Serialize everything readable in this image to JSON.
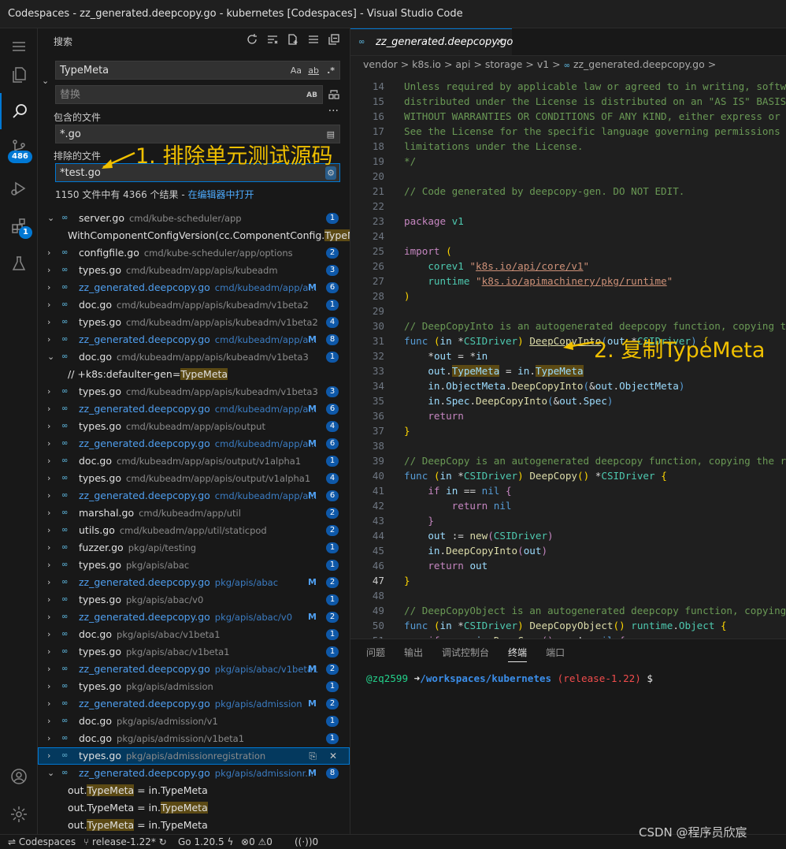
{
  "window": {
    "title": "Codespaces - zz_generated.deepcopy.go - kubernetes [Codespaces] - Visual Studio Code"
  },
  "activity_bar": {
    "source_control_badge": "486",
    "extensions_badge": "1"
  },
  "search": {
    "header": "搜索",
    "query": "TypeMeta",
    "match_case": "Aa",
    "whole_word": "ab",
    "regex": ".*",
    "replace_placeholder": "替换",
    "preserve_case": "AB",
    "include_label": "包含的文件",
    "include_value": "*.go",
    "exclude_label": "排除的文件",
    "exclude_value": "*test.go",
    "summary": "1150 文件中有 4366 个结果 - ",
    "open_in_editor": "在编辑器中打开"
  },
  "results": [
    {
      "kind": "file",
      "expanded": true,
      "name": "server.go",
      "path": "cmd/kube-scheduler/app",
      "count": "1"
    },
    {
      "kind": "match",
      "before": "WithComponentConfigVersion(cc.ComponentConfig.",
      "hit": "TypeMe",
      "after": "..."
    },
    {
      "kind": "file",
      "name": "configfile.go",
      "path": "cmd/kube-scheduler/app/options",
      "count": "2"
    },
    {
      "kind": "file",
      "name": "types.go",
      "path": "cmd/kubeadm/app/apis/kubeadm",
      "count": "3"
    },
    {
      "kind": "file",
      "name": "zz_generated.deepcopy.go",
      "path": "cmd/kubeadm/app/a...",
      "modified": true,
      "m": "M",
      "count": "6"
    },
    {
      "kind": "file",
      "name": "doc.go",
      "path": "cmd/kubeadm/app/apis/kubeadm/v1beta2",
      "count": "1"
    },
    {
      "kind": "file",
      "name": "types.go",
      "path": "cmd/kubeadm/app/apis/kubeadm/v1beta2",
      "count": "4"
    },
    {
      "kind": "file",
      "name": "zz_generated.deepcopy.go",
      "path": "cmd/kubeadm/app/a...",
      "modified": true,
      "m": "M",
      "count": "8"
    },
    {
      "kind": "file",
      "expanded": true,
      "name": "doc.go",
      "path": "cmd/kubeadm/app/apis/kubeadm/v1beta3",
      "count": "1"
    },
    {
      "kind": "match",
      "before": "// +k8s:defaulter-gen=",
      "hit": "TypeMeta",
      "after": ""
    },
    {
      "kind": "file",
      "name": "types.go",
      "path": "cmd/kubeadm/app/apis/kubeadm/v1beta3",
      "count": "3"
    },
    {
      "kind": "file",
      "name": "zz_generated.deepcopy.go",
      "path": "cmd/kubeadm/app/a...",
      "modified": true,
      "m": "M",
      "count": "6"
    },
    {
      "kind": "file",
      "name": "types.go",
      "path": "cmd/kubeadm/app/apis/output",
      "count": "4"
    },
    {
      "kind": "file",
      "name": "zz_generated.deepcopy.go",
      "path": "cmd/kubeadm/app/a...",
      "modified": true,
      "m": "M",
      "count": "6"
    },
    {
      "kind": "file",
      "name": "doc.go",
      "path": "cmd/kubeadm/app/apis/output/v1alpha1",
      "count": "1"
    },
    {
      "kind": "file",
      "name": "types.go",
      "path": "cmd/kubeadm/app/apis/output/v1alpha1",
      "count": "4"
    },
    {
      "kind": "file",
      "name": "zz_generated.deepcopy.go",
      "path": "cmd/kubeadm/app/a...",
      "modified": true,
      "m": "M",
      "count": "6"
    },
    {
      "kind": "file",
      "name": "marshal.go",
      "path": "cmd/kubeadm/app/util",
      "count": "2"
    },
    {
      "kind": "file",
      "name": "utils.go",
      "path": "cmd/kubeadm/app/util/staticpod",
      "count": "2"
    },
    {
      "kind": "file",
      "name": "fuzzer.go",
      "path": "pkg/api/testing",
      "count": "1"
    },
    {
      "kind": "file",
      "name": "types.go",
      "path": "pkg/apis/abac",
      "count": "1"
    },
    {
      "kind": "file",
      "name": "zz_generated.deepcopy.go",
      "path": "pkg/apis/abac",
      "modified": true,
      "m": "M",
      "count": "2"
    },
    {
      "kind": "file",
      "name": "types.go",
      "path": "pkg/apis/abac/v0",
      "count": "1"
    },
    {
      "kind": "file",
      "name": "zz_generated.deepcopy.go",
      "path": "pkg/apis/abac/v0",
      "modified": true,
      "m": "M",
      "count": "2"
    },
    {
      "kind": "file",
      "name": "doc.go",
      "path": "pkg/apis/abac/v1beta1",
      "count": "1"
    },
    {
      "kind": "file",
      "name": "types.go",
      "path": "pkg/apis/abac/v1beta1",
      "count": "1"
    },
    {
      "kind": "file",
      "name": "zz_generated.deepcopy.go",
      "path": "pkg/apis/abac/v1beta1",
      "modified": true,
      "m": "M",
      "count": "2"
    },
    {
      "kind": "file",
      "name": "types.go",
      "path": "pkg/apis/admission",
      "count": "1"
    },
    {
      "kind": "file",
      "name": "zz_generated.deepcopy.go",
      "path": "pkg/apis/admission",
      "modified": true,
      "m": "M",
      "count": "2"
    },
    {
      "kind": "file",
      "name": "doc.go",
      "path": "pkg/apis/admission/v1",
      "count": "1"
    },
    {
      "kind": "file",
      "name": "doc.go",
      "path": "pkg/apis/admission/v1beta1",
      "count": "1"
    },
    {
      "kind": "file",
      "name": "types.go",
      "path": "pkg/apis/admissionregistration",
      "selected": true
    },
    {
      "kind": "file",
      "expanded": true,
      "name": "zz_generated.deepcopy.go",
      "path": "pkg/apis/admissionr...",
      "modified": true,
      "m": "M",
      "count": "8"
    },
    {
      "kind": "match",
      "before": "out.",
      "hit": "TypeMeta",
      "after": " = in.TypeMeta"
    },
    {
      "kind": "match",
      "before": "out.TypeMeta = in.",
      "hit": "TypeMeta",
      "after": ""
    },
    {
      "kind": "match",
      "before": "out.",
      "hit": "TypeMeta",
      "after": " = in.TypeMeta"
    }
  ],
  "editor": {
    "tab": "zz_generated.deepcopy.go",
    "breadcrumb": [
      "vendor",
      "k8s.io",
      "api",
      "storage",
      "v1",
      "zz_generated.deepcopy.go",
      ""
    ],
    "current_line": "47",
    "lines": [
      {
        "n": "14",
        "html": "<span class='cm'>Unless required by applicable law or agreed to in writing, software</span>"
      },
      {
        "n": "15",
        "html": "<span class='cm'>distributed under the License is distributed on an \"AS IS\" BASIS,</span>"
      },
      {
        "n": "16",
        "html": "<span class='cm'>WITHOUT WARRANTIES OR CONDITIONS OF ANY KIND, either express or implied.</span>"
      },
      {
        "n": "17",
        "html": "<span class='cm'>See the License for the specific language governing permissions and</span>"
      },
      {
        "n": "18",
        "html": "<span class='cm'>limitations under the License.</span>"
      },
      {
        "n": "19",
        "html": "<span class='cm'>*/</span>"
      },
      {
        "n": "20",
        "html": ""
      },
      {
        "n": "21",
        "html": "<span class='cm'>// Code generated by deepcopy-gen. DO NOT EDIT.</span>"
      },
      {
        "n": "22",
        "html": ""
      },
      {
        "n": "23",
        "html": "<span class='k'>package</span> <span class='ty'>v1</span>"
      },
      {
        "n": "24",
        "html": ""
      },
      {
        "n": "25",
        "html": "<span class='k'>import</span> <span class='y'>(</span>"
      },
      {
        "n": "26",
        "html": "    <span class='ty'>corev1</span> <span class='s'>\"<u>k8s.io/api/core/v1</u>\"</span>"
      },
      {
        "n": "27",
        "html": "    <span class='ty'>runtime</span> <span class='s'>\"<u>k8s.io/apimachinery/pkg/runtime</u>\"</span>"
      },
      {
        "n": "28",
        "html": "<span class='y'>)</span>"
      },
      {
        "n": "29",
        "html": ""
      },
      {
        "n": "30",
        "html": "<span class='cm'>// DeepCopyInto is an autogenerated deepcopy function, copying the receiver</span>"
      },
      {
        "n": "31",
        "html": "<span class='kw'>func</span> <span class='y'>(</span><span class='v'>in</span> <span class='p'>*</span><span class='ty'>CSIDriver</span><span class='y'>)</span> <span class='fn'><u>DeepCopyInto</u></span><span class='kw'>(</span><span class='v'>out</span> <span class='p'>*</span><span class='ty'>CSIDriver</span><span class='kw'>)</span> <span class='y'>{</span>"
      },
      {
        "n": "32",
        "html": "    <span class='p'>*</span><span class='v'>out</span> <span class='p'>=</span> <span class='p'>*</span><span class='v'>in</span>"
      },
      {
        "n": "33",
        "html": "    <span class='v'>out</span><span class='p'>.</span><span class='v hlw'>TypeMeta</span> <span class='p'>=</span> <span class='v'>in</span><span class='p'>.</span><span class='v hlw'>TypeMeta</span>"
      },
      {
        "n": "34",
        "html": "    <span class='v'>in</span><span class='p'>.</span><span class='v'>ObjectMeta</span><span class='p'>.</span><span class='fn'>DeepCopyInto</span><span class='kw'>(</span><span class='p'>&amp;</span><span class='v'>out</span><span class='p'>.</span><span class='v'>ObjectMeta</span><span class='kw'>)</span>"
      },
      {
        "n": "35",
        "html": "    <span class='v'>in</span><span class='p'>.</span><span class='v'>Spec</span><span class='p'>.</span><span class='fn'>DeepCopyInto</span><span class='kw'>(</span><span class='p'>&amp;</span><span class='v'>out</span><span class='p'>.</span><span class='v'>Spec</span><span class='kw'>)</span>"
      },
      {
        "n": "36",
        "html": "    <span class='k'>return</span>"
      },
      {
        "n": "37",
        "html": "<span class='y'>}</span>"
      },
      {
        "n": "38",
        "html": ""
      },
      {
        "n": "39",
        "html": "<span class='cm'>// DeepCopy is an autogenerated deepcopy function, copying the receiver</span>"
      },
      {
        "n": "40",
        "html": "<span class='kw'>func</span> <span class='y'>(</span><span class='v'>in</span> <span class='p'>*</span><span class='ty'>CSIDriver</span><span class='y'>)</span> <span class='fn'>DeepCopy</span><span class='y'>()</span> <span class='p'>*</span><span class='ty'>CSIDriver</span> <span class='y'>{</span>"
      },
      {
        "n": "41",
        "html": "    <span class='k'>if</span> <span class='v'>in</span> <span class='p'>==</span> <span class='kw'>nil</span> <span class='k'>{</span>"
      },
      {
        "n": "42",
        "html": "        <span class='k'>return</span> <span class='kw'>nil</span>"
      },
      {
        "n": "43",
        "html": "    <span class='k'>}</span>"
      },
      {
        "n": "44",
        "html": "    <span class='v'>out</span> <span class='p'>:=</span> <span class='fn'>new</span><span class='k'>(</span><span class='ty'>CSIDriver</span><span class='k'>)</span>"
      },
      {
        "n": "45",
        "html": "    <span class='v'>in</span><span class='p'>.</span><span class='fn'>DeepCopyInto</span><span class='k'>(</span><span class='v'>out</span><span class='k'>)</span>"
      },
      {
        "n": "46",
        "html": "    <span class='k'>return</span> <span class='v'>out</span>"
      },
      {
        "n": "47",
        "html": "<span class='y'>}</span>"
      },
      {
        "n": "48",
        "html": ""
      },
      {
        "n": "49",
        "html": "<span class='cm'>// DeepCopyObject is an autogenerated deepcopy function, copying the receiver</span>"
      },
      {
        "n": "50",
        "html": "<span class='kw'>func</span> <span class='y'>(</span><span class='v'>in</span> <span class='p'>*</span><span class='ty'>CSIDriver</span><span class='y'>)</span> <span class='fn'>DeepCopyObject</span><span class='y'>()</span> <span class='ty'>runtime</span><span class='p'>.</span><span class='ty'>Object</span> <span class='y'>{</span>"
      },
      {
        "n": "51",
        "html": "    <span class='k'>if</span> <span class='v'>c</span> <span class='p'>:=</span> <span class='v'>in</span><span class='p'>.</span><span class='fn'>DeepCopy</span><span class='k'>()</span><span class='p'>;</span> <span class='v'>c</span> <span class='p'>!=</span> <span class='kw'>nil</span> <span class='k'>{</span>"
      }
    ]
  },
  "panel": {
    "tabs": [
      "问题",
      "输出",
      "调试控制台",
      "终端",
      "端口"
    ],
    "active_tab": "终端",
    "prompt_user": "@zq2599",
    "prompt_arrow": "➜",
    "prompt_path": "/workspaces/kubernetes",
    "prompt_branch": "(release-1.22)",
    "prompt_symbol": "$"
  },
  "status": {
    "remote": "Codespaces",
    "branch": "release-1.22*",
    "go_version": "Go 1.20.5",
    "errors": "0",
    "warnings": "0",
    "ports": "0"
  },
  "annotations": {
    "one": "1. 排除单元测试源码",
    "two": "2. 复制TypeMeta"
  },
  "watermark": "CSDN @程序员欣宸",
  "colors": {
    "accent": "#0078d4",
    "annotation": "#f0c000",
    "modified": "#4f9ff0"
  }
}
